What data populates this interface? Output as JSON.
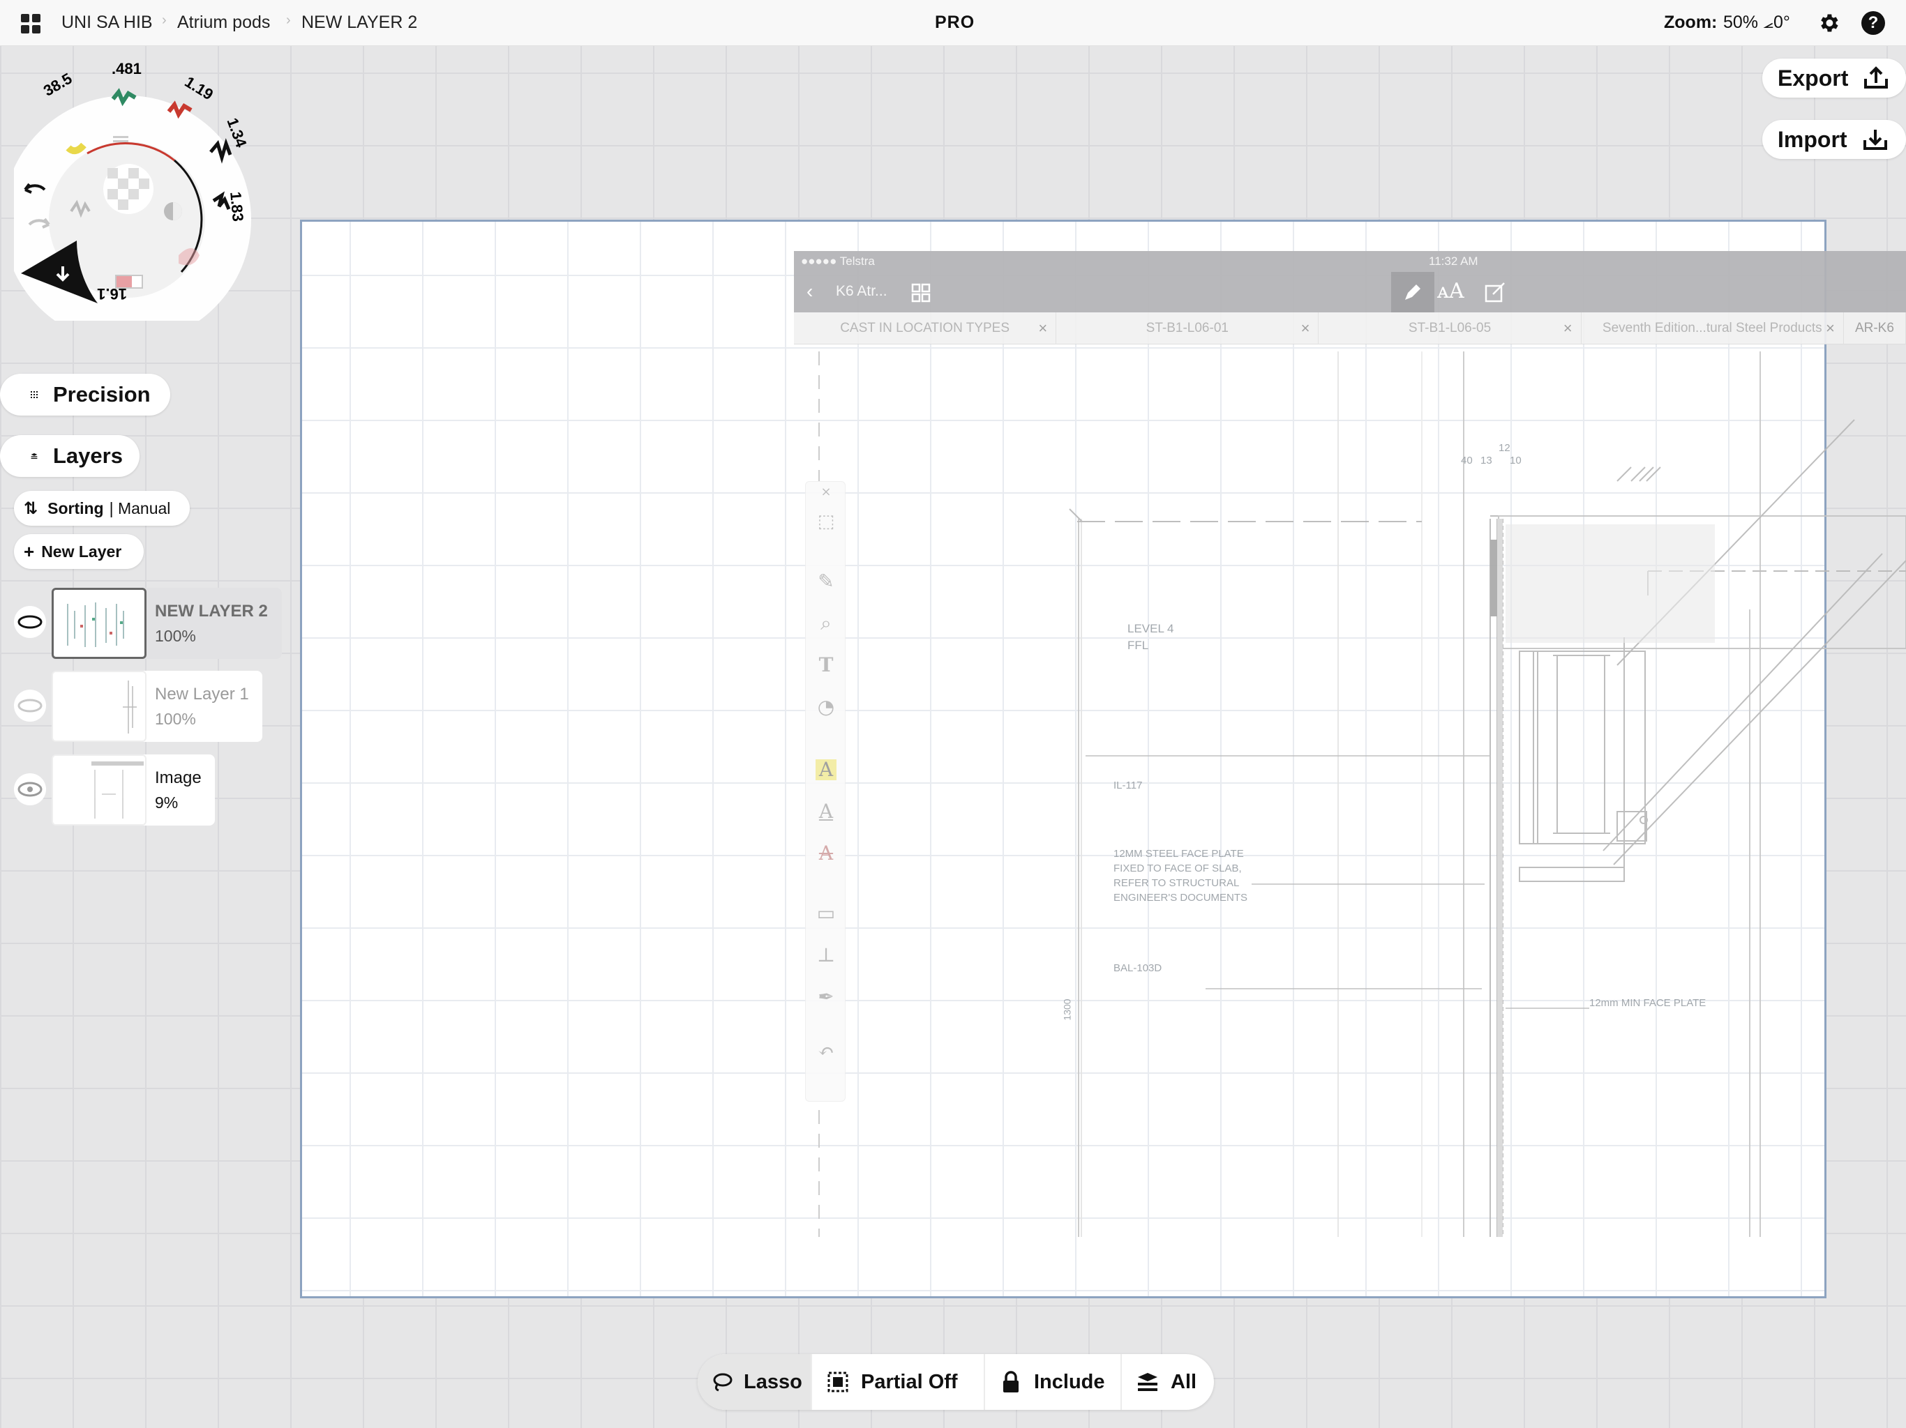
{
  "topbar": {
    "breadcrumbs": [
      "UNI SA HIB",
      "Atrium pods",
      "NEW LAYER 2"
    ],
    "badge": "PRO",
    "zoom_label": "Zoom:",
    "zoom_value": "50% ⦟0°"
  },
  "actions": {
    "export_label": "Export",
    "import_label": "Import"
  },
  "brush_wheel": {
    "sizes": [
      "38.5",
      ".481",
      "1.19",
      "1.34",
      "1.83",
      "16.1"
    ],
    "colors": {
      "yellow": "#e9d84a",
      "green": "#2f8a63",
      "red": "#c8392f",
      "black": "#111111",
      "pink": "#e8a0a4"
    }
  },
  "panel": {
    "precision_label": "Precision",
    "layers_label": "Layers",
    "sorting_label": "Sorting",
    "sorting_value": "| Manual",
    "new_layer_label": "New Layer",
    "layers": [
      {
        "name": "NEW LAYER 2",
        "opacity": "100%",
        "visible": true,
        "selected": true
      },
      {
        "name": "New Layer 1",
        "opacity": "100%",
        "visible": false,
        "selected": false
      },
      {
        "name": "Image",
        "opacity": "9%",
        "visible": true,
        "selected": false
      }
    ]
  },
  "imported_screenshot": {
    "status_carrier": "●●●●● Telstra",
    "status_time": "11:32 AM",
    "nav_back_title": "K6 Atr...",
    "tabs": [
      "CAST IN LOCATION TYPES",
      "ST-B1-L06-01",
      "ST-B1-L06-05",
      "Seventh Edition...tural Steel Products",
      "AR-K6"
    ],
    "drawing_labels": {
      "level": "LEVEL 4",
      "ffl": "FFL",
      "il": "IL-117",
      "plate_line1": "12MM STEEL FACE PLATE",
      "plate_line2": "FIXED TO FACE OF SLAB,",
      "plate_line3": "REFER TO STRUCTURAL",
      "plate_line4": "ENGINEER'S DOCUMENTS",
      "bal": "BAL-103D",
      "min_plate": "12mm MIN FACE PLATE",
      "dim_vertical": "1300",
      "dim_40": "40",
      "dim_13": "13",
      "dim_12": "12",
      "dim_10": "10"
    }
  },
  "selection_bar": {
    "lasso_label": "Lasso",
    "partial_label": "Partial Off",
    "include_label": "Include",
    "all_label": "All"
  }
}
